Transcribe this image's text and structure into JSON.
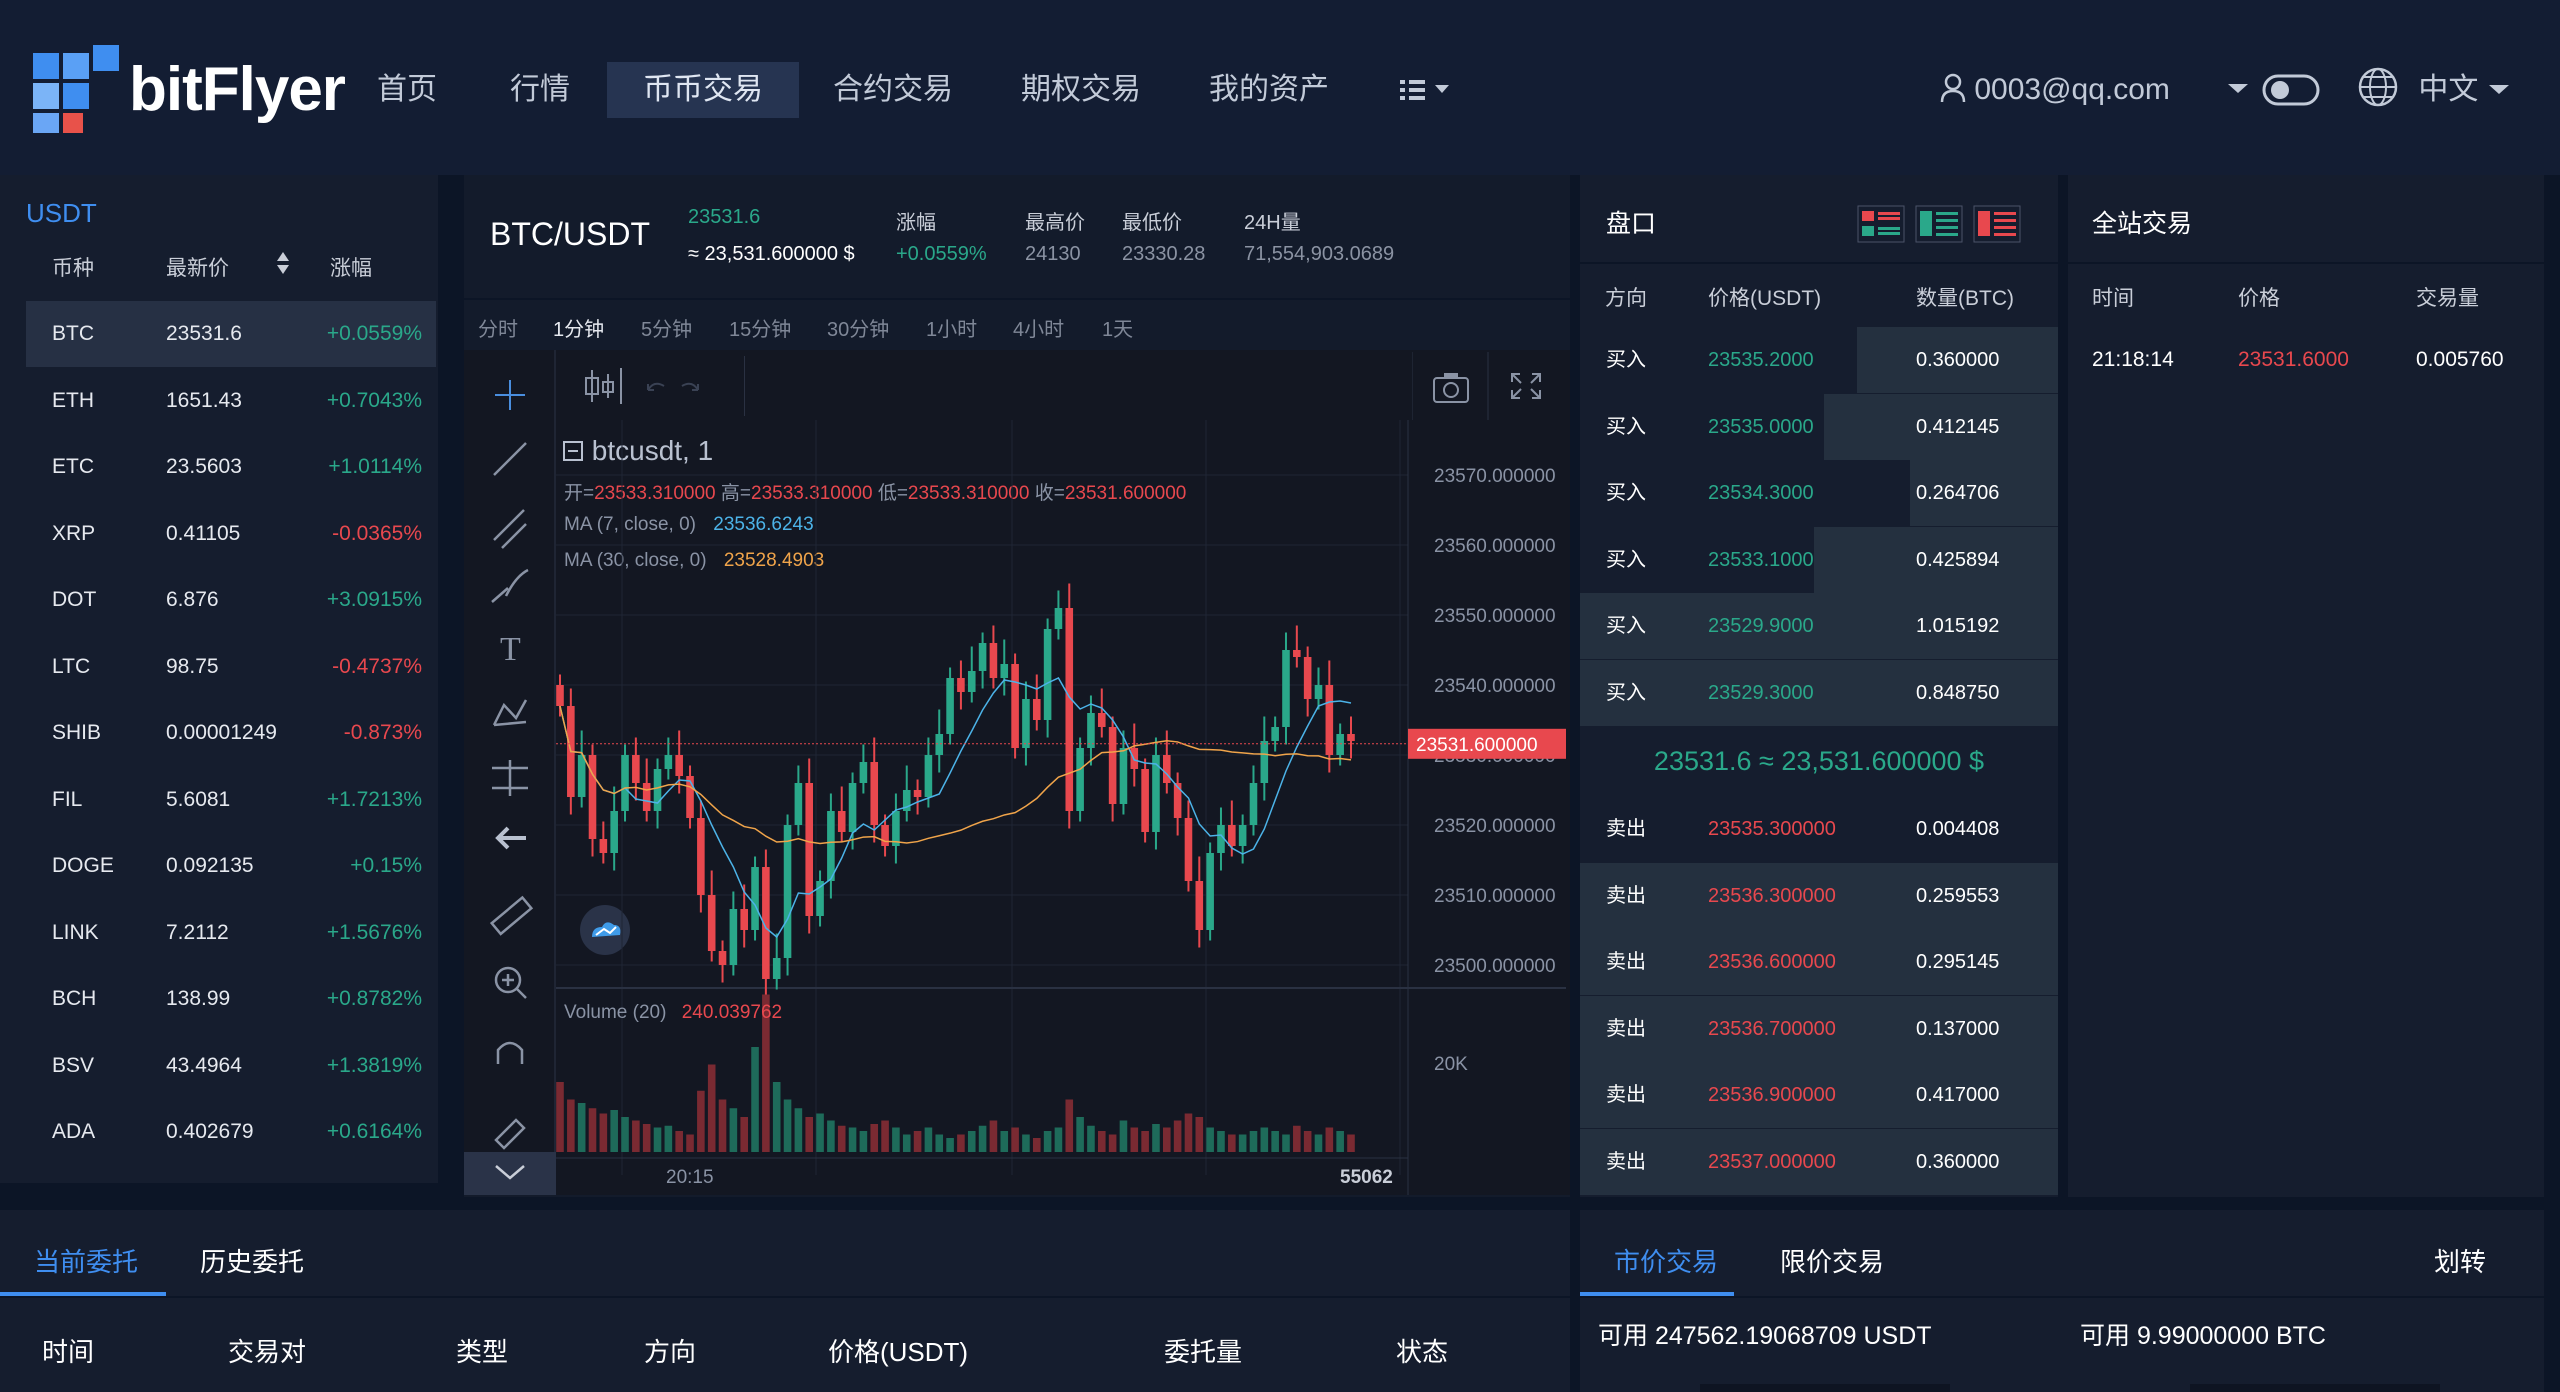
{
  "header": {
    "logo_text": "bitFlyer",
    "nav": [
      "首页",
      "行情",
      "币币交易",
      "合约交易",
      "期权交易",
      "我的资产"
    ],
    "active_nav": "币币交易",
    "menu_icon": "list-icon",
    "user": "0003@qq.com",
    "language": "中文"
  },
  "market": {
    "quote": "USDT",
    "columns": [
      "币种",
      "最新价",
      "涨幅"
    ],
    "rows": [
      {
        "coin": "BTC",
        "price": "23531.6",
        "change": "+0.0559%",
        "up": true
      },
      {
        "coin": "ETH",
        "price": "1651.43",
        "change": "+0.7043%",
        "up": true
      },
      {
        "coin": "ETC",
        "price": "23.5603",
        "change": "+1.0114%",
        "up": true
      },
      {
        "coin": "XRP",
        "price": "0.41105",
        "change": "-0.0365%",
        "up": false
      },
      {
        "coin": "DOT",
        "price": "6.876",
        "change": "+3.0915%",
        "up": true
      },
      {
        "coin": "LTC",
        "price": "98.75",
        "change": "-0.4737%",
        "up": false
      },
      {
        "coin": "SHIB",
        "price": "0.00001249",
        "change": "-0.873%",
        "up": false
      },
      {
        "coin": "FIL",
        "price": "5.6081",
        "change": "+1.7213%",
        "up": true
      },
      {
        "coin": "DOGE",
        "price": "0.092135",
        "change": "+0.15%",
        "up": true
      },
      {
        "coin": "LINK",
        "price": "7.2112",
        "change": "+1.5676%",
        "up": true
      },
      {
        "coin": "BCH",
        "price": "138.99",
        "change": "+0.8782%",
        "up": true
      },
      {
        "coin": "BSV",
        "price": "43.4964",
        "change": "+1.3819%",
        "up": true
      },
      {
        "coin": "ADA",
        "price": "0.402679",
        "change": "+0.6164%",
        "up": true
      }
    ]
  },
  "ticker": {
    "pair": "BTC/USDT",
    "last": "23531.6",
    "last_usd": "≈ 23,531.600000 $",
    "change_label": "涨幅",
    "change": "+0.0559%",
    "high_label": "最高价",
    "high": "24130",
    "low_label": "最低价",
    "low": "23330.28",
    "vol_label": "24H量",
    "vol": "71,554,903.0689"
  },
  "timeframes": [
    "分时",
    "1分钟",
    "5分钟",
    "15分钟",
    "30分钟",
    "1小时",
    "4小时",
    "1天"
  ],
  "active_timeframe": "1分钟",
  "chart_data": {
    "type": "candlestick",
    "symbol": "btcusdt, 1",
    "ohlc_labels": {
      "open": "开=",
      "open_val": "23533.310000",
      "high": "高=",
      "high_val": "23533.310000",
      "low": "低=",
      "low_val": "23533.310000",
      "close": "收=",
      "close_val": "23531.600000"
    },
    "ma7_label": "MA (7, close, 0)",
    "ma7_val": "23536.6243",
    "ma30_label": "MA (30, close, 0)",
    "ma30_val": "23528.4903",
    "volume_label": "Volume (20)",
    "volume_val": "240.039762",
    "y_ticks": [
      "23570.000000",
      "23560.000000",
      "23550.000000",
      "23540.000000",
      "23530.000000",
      "23520.000000",
      "23510.000000",
      "23500.000000"
    ],
    "y_tick_values": [
      23570,
      23560,
      23550,
      23540,
      23530,
      23520,
      23510,
      23500
    ],
    "ylim": [
      23495,
      23575
    ],
    "current_price_label": "23531.600000",
    "current_price": 23531.6,
    "volume_tick": "20K",
    "x_ticks": [
      "20:15",
      "55062"
    ],
    "closes": [
      23537,
      23524,
      23530,
      23518,
      23516,
      23522,
      23530,
      23526,
      23522,
      23528,
      23530,
      23527,
      23521,
      23510,
      23502,
      23500,
      23508,
      23505,
      23514,
      23498,
      23501,
      23520,
      23526,
      23507,
      23512,
      23522,
      23519,
      23526,
      23529,
      23520,
      23517,
      23522,
      23525,
      23524,
      23530,
      23533,
      23541,
      23539,
      23542,
      23546,
      23541,
      23543,
      23531,
      23538,
      23535,
      23548,
      23551,
      23522,
      23531,
      23536,
      23534,
      23523,
      23531,
      23528,
      23519,
      23530,
      23526,
      23521,
      23512,
      23505,
      23516,
      23520,
      23517,
      23520,
      23526,
      23532,
      23534,
      23545,
      23544,
      23538,
      23540,
      23530,
      23533,
      23532
    ],
    "volumes": [
      40,
      30,
      28,
      25,
      22,
      24,
      20,
      18,
      16,
      14,
      15,
      12,
      10,
      35,
      50,
      30,
      25,
      20,
      60,
      90,
      40,
      30,
      25,
      20,
      22,
      18,
      15,
      14,
      12,
      16,
      18,
      14,
      10,
      12,
      14,
      10,
      8,
      10,
      12,
      15,
      18,
      12,
      14,
      10,
      8,
      12,
      14,
      30,
      20,
      15,
      12,
      10,
      18,
      14,
      12,
      16,
      14,
      18,
      22,
      20,
      14,
      12,
      10,
      10,
      12,
      14,
      12,
      10,
      15,
      12,
      10,
      14,
      12,
      10
    ]
  },
  "orderbook": {
    "title": "盘口",
    "columns": [
      "方向",
      "价格(USDT)",
      "数量(BTC)"
    ],
    "buys": [
      {
        "side": "买入",
        "price": "23535.2000",
        "qty": "0.360000",
        "depth": 0.42
      },
      {
        "side": "买入",
        "price": "23535.0000",
        "qty": "0.412145",
        "depth": 0.49
      },
      {
        "side": "买入",
        "price": "23534.3000",
        "qty": "0.264706",
        "depth": 0.31
      },
      {
        "side": "买入",
        "price": "23533.1000",
        "qty": "0.425894",
        "depth": 0.51
      },
      {
        "side": "买入",
        "price": "23529.9000",
        "qty": "1.015192",
        "depth": 1.0
      },
      {
        "side": "买入",
        "price": "23529.3000",
        "qty": "0.848750",
        "depth": 1.0
      }
    ],
    "mid_price": "23531.6",
    "mid_usd": "≈ 23,531.600000 $",
    "sells": [
      {
        "side": "卖出",
        "price": "23535.300000",
        "qty": "0.004408",
        "depth": 0.0
      },
      {
        "side": "卖出",
        "price": "23536.300000",
        "qty": "0.259553",
        "depth": 1.0
      },
      {
        "side": "卖出",
        "price": "23536.600000",
        "qty": "0.295145",
        "depth": 1.0
      },
      {
        "side": "卖出",
        "price": "23536.700000",
        "qty": "0.137000",
        "depth": 1.0
      },
      {
        "side": "卖出",
        "price": "23536.900000",
        "qty": "0.417000",
        "depth": 1.0
      },
      {
        "side": "卖出",
        "price": "23537.000000",
        "qty": "0.360000",
        "depth": 1.0
      }
    ]
  },
  "trades": {
    "title": "全站交易",
    "columns": [
      "时间",
      "价格",
      "交易量"
    ],
    "rows": [
      {
        "time": "21:18:14",
        "price": "23531.6000",
        "qty": "0.005760"
      }
    ]
  },
  "orders": {
    "tabs": [
      "当前委托",
      "历史委托"
    ],
    "active_tab": "当前委托",
    "columns": [
      "时间",
      "交易对",
      "类型",
      "方向",
      "价格(USDT)",
      "委托量",
      "状态"
    ]
  },
  "trade_form": {
    "tabs": [
      "市价交易",
      "限价交易"
    ],
    "active_tab": "市价交易",
    "transfer": "划转",
    "avail_usdt": "可用 247562.19068709 USDT",
    "avail_btc": "可用 9.99000000 BTC"
  },
  "colors": {
    "up": "#2aa88a",
    "down": "#e8484e",
    "accent": "#3f8ef0",
    "bg": "#0c1526",
    "panel": "#151d2e"
  }
}
